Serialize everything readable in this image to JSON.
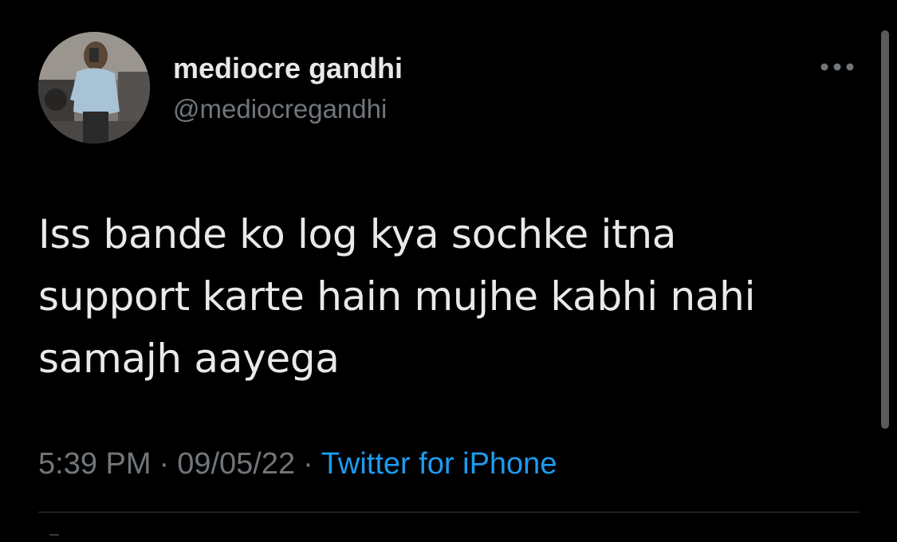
{
  "tweet": {
    "author": {
      "name": "mediocre gandhi",
      "handle": "@mediocregandhi"
    },
    "text_lines": [
      "Iss bande ko log kya sochke itna",
      "support karte hain mujhe kabhi nahi",
      "samajh aayega"
    ],
    "time": "5:39 PM",
    "date": "09/05/22",
    "separator": "·",
    "source": "Twitter for iPhone",
    "more_icon": "more-horizontal-icon"
  },
  "colors": {
    "background": "#000000",
    "text": "#e7e9ea",
    "secondary": "#71767b",
    "link": "#1d9bf0",
    "divider": "#2f3336"
  }
}
